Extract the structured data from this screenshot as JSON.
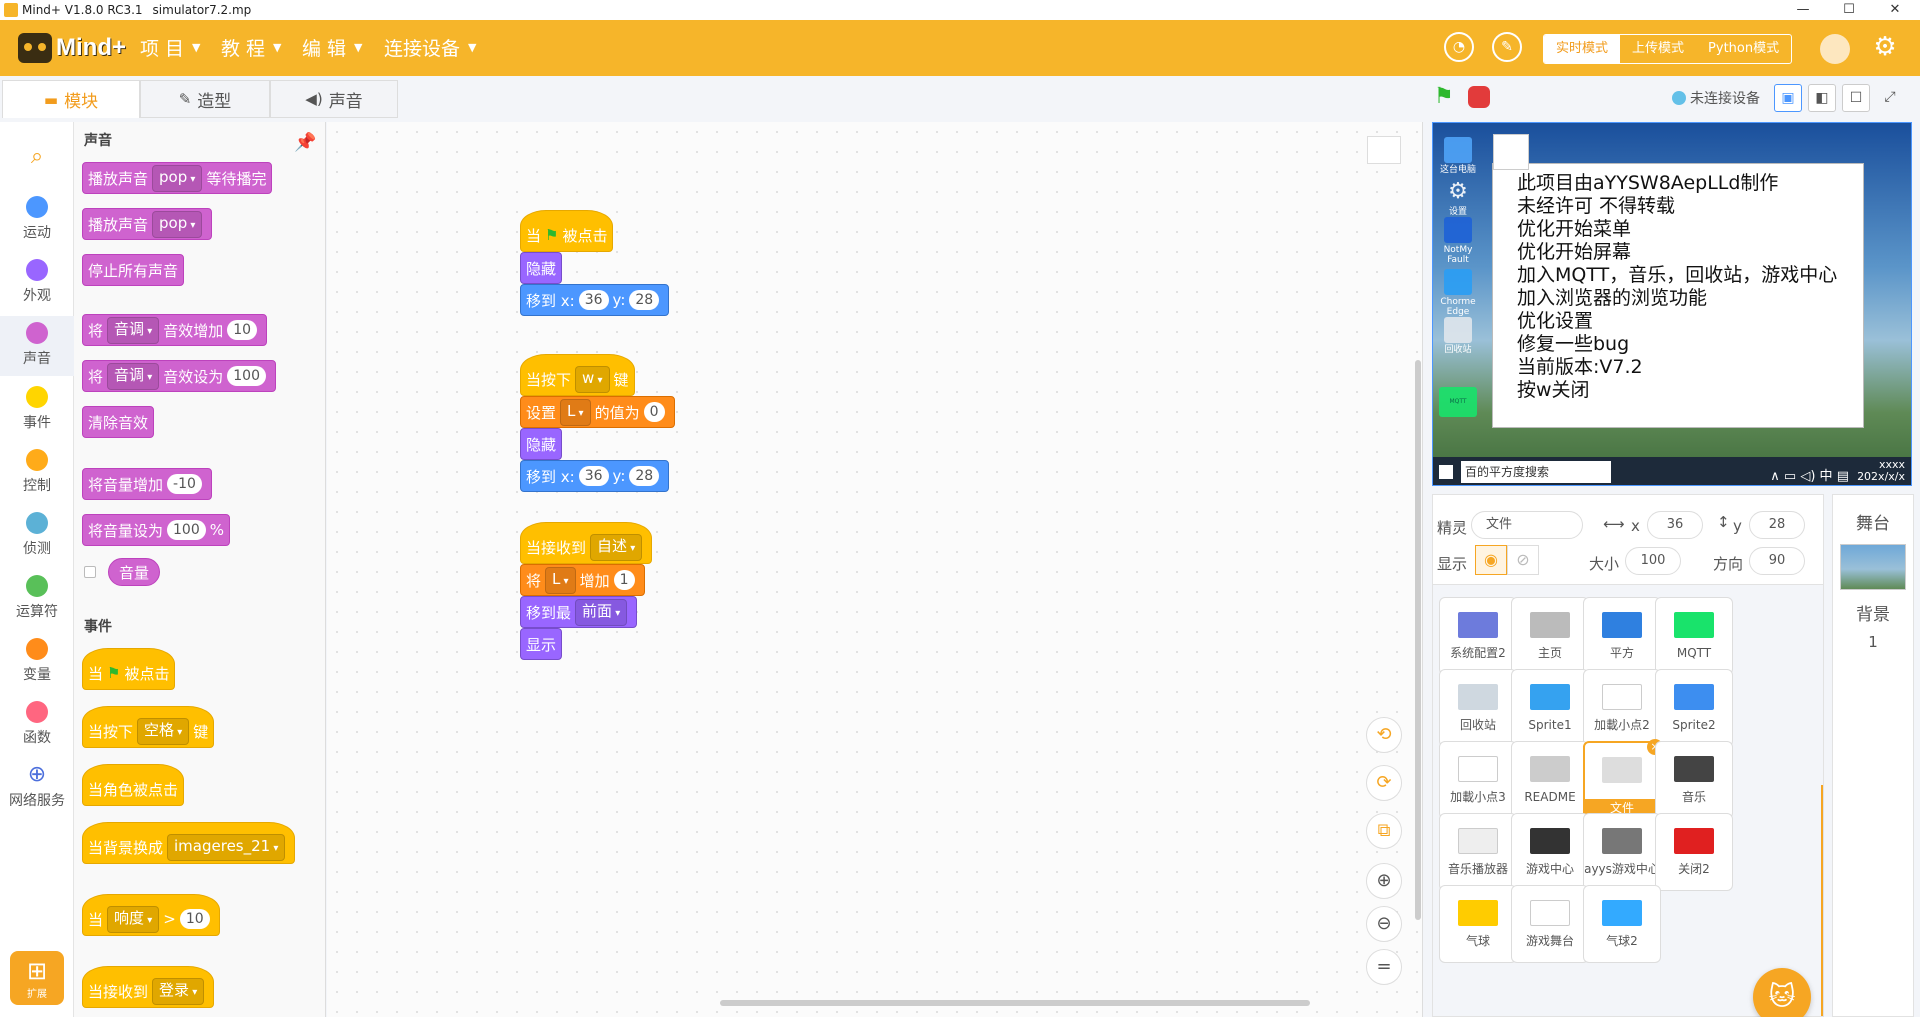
{
  "window": {
    "app_title": "Mind+ V1.8.0 RC3.1",
    "file_name": "simulator7.2.mp"
  },
  "menubar": {
    "brand": "Mind+",
    "menus": [
      {
        "label": "项 目"
      },
      {
        "label": "教 程"
      },
      {
        "label": "编 辑"
      },
      {
        "label": "连接设备"
      }
    ],
    "modes": {
      "realtime": "实时模式",
      "upload": "上传模式",
      "python": "Python模式"
    },
    "colors": {
      "accent": "#f6b52a",
      "active_text": "#f29c1d"
    }
  },
  "tabs": {
    "blocks": "模块",
    "costumes": "造型",
    "sounds": "声音"
  },
  "categories": [
    {
      "label": "运动",
      "color": "#4c97ff"
    },
    {
      "label": "外观",
      "color": "#9966ff"
    },
    {
      "label": "声音",
      "color": "#cf63cf"
    },
    {
      "label": "事件",
      "color": "#ffd500"
    },
    {
      "label": "控制",
      "color": "#ffab19"
    },
    {
      "label": "侦测",
      "color": "#5cb1d6"
    },
    {
      "label": "运算符",
      "color": "#59c059"
    },
    {
      "label": "变量",
      "color": "#ff8c1a"
    },
    {
      "label": "函数",
      "color": "#ff6680"
    },
    {
      "label": "网络服务",
      "color": "#4c6fdc"
    }
  ],
  "extension_label": "扩展",
  "palette": {
    "sound_title": "声音",
    "play_sound_until_done": {
      "a": "播放声音",
      "sound": "pop",
      "b": "等待播完"
    },
    "play_sound": {
      "a": "播放声音",
      "sound": "pop"
    },
    "stop_all_sounds": "停止所有声音",
    "change_effect": {
      "a": "将",
      "effect": "音调",
      "b": "音效增加",
      "value": "10"
    },
    "set_effect": {
      "a": "将",
      "effect": "音调",
      "b": "音效设为",
      "value": "100"
    },
    "clear_effects": "清除音效",
    "change_volume": {
      "a": "将音量增加",
      "value": "-10"
    },
    "set_volume": {
      "a": "将音量设为",
      "value": "100",
      "unit": "%"
    },
    "volume_reporter": "音量",
    "events_title": "事件",
    "when_flag": {
      "a": "当",
      "b": "被点击"
    },
    "when_key": {
      "a": "当按下",
      "key": "空格",
      "b": "键"
    },
    "when_sprite_clicked": "当角色被点击",
    "when_backdrop": {
      "a": "当背景换成",
      "backdrop": "imageres_21"
    },
    "when_loudness": {
      "a": "当",
      "sensor": "响度",
      "op": ">",
      "value": "10"
    },
    "when_receive": {
      "a": "当接收到",
      "msg": "登录"
    }
  },
  "scripts": {
    "s1": {
      "hat": {
        "a": "当",
        "b": "被点击"
      },
      "hide": "隐藏",
      "goto": {
        "a": "移到 x:",
        "x": "36",
        "b": "y:",
        "y": "28"
      }
    },
    "s2": {
      "hat": {
        "a": "当按下",
        "key": "w",
        "b": "键"
      },
      "setvar": {
        "a": "设置",
        "var": "L",
        "b": "的值为",
        "value": "0"
      },
      "hide": "隐藏",
      "goto": {
        "a": "移到 x:",
        "x": "36",
        "b": "y:",
        "y": "28"
      }
    },
    "s3": {
      "hat": {
        "a": "当接收到",
        "msg": "自述"
      },
      "changevar": {
        "a": "将",
        "var": "L",
        "b": "增加",
        "value": "1"
      },
      "front": {
        "a": "移到最",
        "layer": "前面"
      },
      "show": "显示"
    }
  },
  "stage_header": {
    "connection": "未连接设备"
  },
  "stage": {
    "desktop_icons": [
      "这台电脑",
      "设置",
      "NotMy Fault",
      "Chorme Edge",
      "回收站",
      "MQTT"
    ],
    "notice_lines": [
      "此项目由aYYSW8AepLLd制作",
      "未经许可 不得转载",
      "优化开始菜单",
      "优化开始屏幕",
      "加入MQTT，音乐，回收站，游戏中心",
      "加入浏览器的浏览功能",
      "优化设置",
      "修复一些bug",
      "当前版本:V7.2",
      "按w关闭"
    ],
    "taskbar": {
      "search": "百的平方度搜索",
      "ime": "中",
      "tray_top": "xxxx",
      "tray_date": "202x/x/x"
    }
  },
  "sprite_info": {
    "sprite_label": "精灵",
    "sprite_name": "文件",
    "x_label": "x",
    "x": "36",
    "y_label": "y",
    "y": "28",
    "show_label": "显示",
    "size_label": "大小",
    "size": "100",
    "direction_label": "方向",
    "direction": "90"
  },
  "sprites": [
    {
      "name": "系统配置2",
      "color": "#6d7bdc"
    },
    {
      "name": "主页",
      "color": "#bbbbbb"
    },
    {
      "name": "平方",
      "color": "#2f80e0"
    },
    {
      "name": "MQTT",
      "color": "#19e36b"
    },
    {
      "name": "回收站",
      "color": "#cfd8e0"
    },
    {
      "name": "Sprite1",
      "color": "#35a2f0"
    },
    {
      "name": "加載小点2",
      "color": "#ffffff"
    },
    {
      "name": "Sprite2",
      "color": "#3d8ef0"
    },
    {
      "name": "加載小点3",
      "color": "#ffffff"
    },
    {
      "name": "README",
      "color": "#cccccc"
    },
    {
      "name": "文件",
      "color": "#dddddd"
    },
    {
      "name": "音乐",
      "color": "#444444"
    },
    {
      "name": "音乐播放器",
      "color": "#eeeeee"
    },
    {
      "name": "游戏中心",
      "color": "#333333"
    },
    {
      "name": "ayys游戏中心",
      "color": "#777777"
    },
    {
      "name": "关闭2",
      "color": "#e02020"
    },
    {
      "name": "气球",
      "color": "#ffcc00"
    },
    {
      "name": "游戏舞台",
      "color": "#ffffff"
    },
    {
      "name": "气球2",
      "color": "#33aaff"
    }
  ],
  "stage_panel": {
    "title": "舞台",
    "backdrop_label": "背景",
    "backdrop_count": "1"
  }
}
